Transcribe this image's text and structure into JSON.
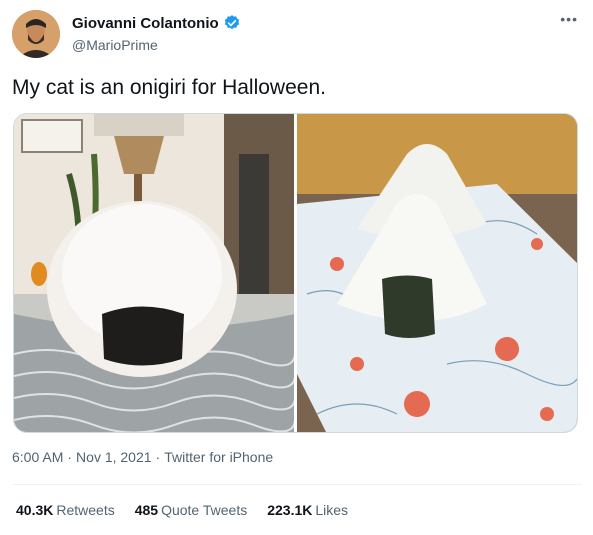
{
  "author": {
    "display_name": "Giovanni Colantonio",
    "handle": "@MarioPrime",
    "verified": true,
    "avatar_icon": "profile-avatar"
  },
  "more_icon": "more-options-icon",
  "tweet": {
    "text": "My cat is an onigiri for Halloween."
  },
  "media": [
    {
      "kind": "photo",
      "subject": "cat"
    },
    {
      "kind": "photo",
      "subject": "onigiri"
    }
  ],
  "meta": {
    "time": "6:00 AM",
    "sep1": "·",
    "date": "Nov 1, 2021",
    "sep2": "·",
    "source": "Twitter for iPhone"
  },
  "stats": {
    "retweets_count": "40.3K",
    "retweets_label": "Retweets",
    "quotes_count": "485",
    "quotes_label": "Quote Tweets",
    "likes_count": "223.1K",
    "likes_label": "Likes"
  },
  "colors": {
    "verified_blue": "#1d9bf0",
    "secondary_text": "#536471",
    "primary_text": "#0f1419"
  }
}
